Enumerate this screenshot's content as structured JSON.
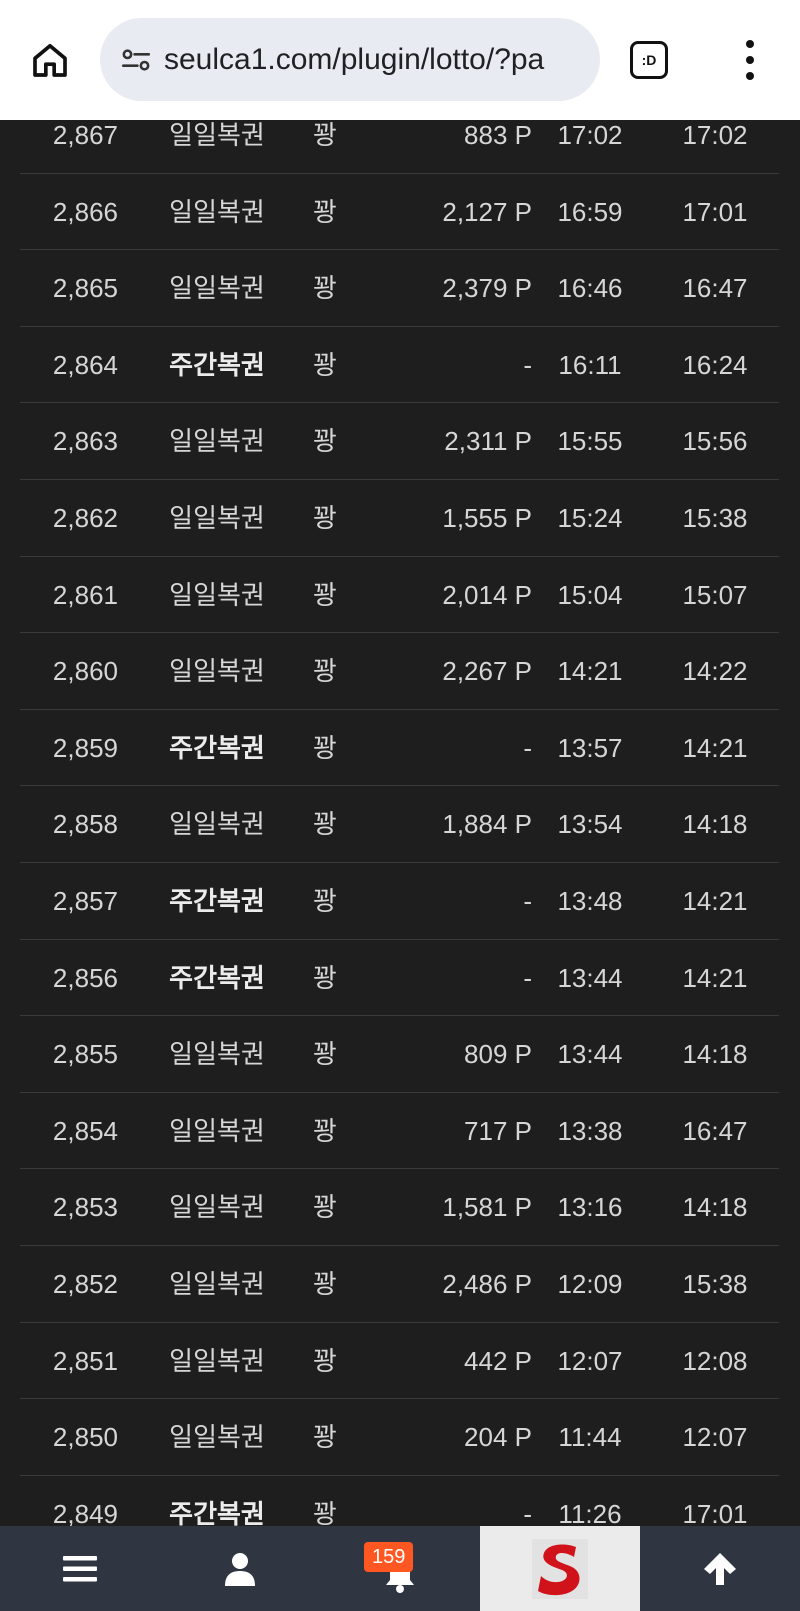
{
  "browser": {
    "url": "seulca1.com/plugin/lotto/?pa",
    "tab_label": ":D",
    "icons": [
      "home-icon",
      "site-info-icon",
      "tab-switcher-icon",
      "more-menu-icon"
    ]
  },
  "rows": [
    {
      "num": "2,867",
      "type": "일일복권",
      "bold": false,
      "result": "꽝",
      "points": "883 P",
      "time1": "17:02",
      "time2": "17:02"
    },
    {
      "num": "2,866",
      "type": "일일복권",
      "bold": false,
      "result": "꽝",
      "points": "2,127 P",
      "time1": "16:59",
      "time2": "17:01"
    },
    {
      "num": "2,865",
      "type": "일일복권",
      "bold": false,
      "result": "꽝",
      "points": "2,379 P",
      "time1": "16:46",
      "time2": "16:47"
    },
    {
      "num": "2,864",
      "type": "주간복권",
      "bold": true,
      "result": "꽝",
      "points": "-",
      "time1": "16:11",
      "time2": "16:24"
    },
    {
      "num": "2,863",
      "type": "일일복권",
      "bold": false,
      "result": "꽝",
      "points": "2,311 P",
      "time1": "15:55",
      "time2": "15:56"
    },
    {
      "num": "2,862",
      "type": "일일복권",
      "bold": false,
      "result": "꽝",
      "points": "1,555 P",
      "time1": "15:24",
      "time2": "15:38"
    },
    {
      "num": "2,861",
      "type": "일일복권",
      "bold": false,
      "result": "꽝",
      "points": "2,014 P",
      "time1": "15:04",
      "time2": "15:07"
    },
    {
      "num": "2,860",
      "type": "일일복권",
      "bold": false,
      "result": "꽝",
      "points": "2,267 P",
      "time1": "14:21",
      "time2": "14:22"
    },
    {
      "num": "2,859",
      "type": "주간복권",
      "bold": true,
      "result": "꽝",
      "points": "-",
      "time1": "13:57",
      "time2": "14:21"
    },
    {
      "num": "2,858",
      "type": "일일복권",
      "bold": false,
      "result": "꽝",
      "points": "1,884 P",
      "time1": "13:54",
      "time2": "14:18"
    },
    {
      "num": "2,857",
      "type": "주간복권",
      "bold": true,
      "result": "꽝",
      "points": "-",
      "time1": "13:48",
      "time2": "14:21"
    },
    {
      "num": "2,856",
      "type": "주간복권",
      "bold": true,
      "result": "꽝",
      "points": "-",
      "time1": "13:44",
      "time2": "14:21"
    },
    {
      "num": "2,855",
      "type": "일일복권",
      "bold": false,
      "result": "꽝",
      "points": "809 P",
      "time1": "13:44",
      "time2": "14:18"
    },
    {
      "num": "2,854",
      "type": "일일복권",
      "bold": false,
      "result": "꽝",
      "points": "717 P",
      "time1": "13:38",
      "time2": "16:47"
    },
    {
      "num": "2,853",
      "type": "일일복권",
      "bold": false,
      "result": "꽝",
      "points": "1,581 P",
      "time1": "13:16",
      "time2": "14:18"
    },
    {
      "num": "2,852",
      "type": "일일복권",
      "bold": false,
      "result": "꽝",
      "points": "2,486 P",
      "time1": "12:09",
      "time2": "15:38"
    },
    {
      "num": "2,851",
      "type": "일일복권",
      "bold": false,
      "result": "꽝",
      "points": "442 P",
      "time1": "12:07",
      "time2": "12:08"
    },
    {
      "num": "2,850",
      "type": "일일복권",
      "bold": false,
      "result": "꽝",
      "points": "204 P",
      "time1": "11:44",
      "time2": "12:07"
    },
    {
      "num": "2,849",
      "type": "주간복권",
      "bold": true,
      "result": "꽝",
      "points": "-",
      "time1": "11:26",
      "time2": "17:01"
    }
  ],
  "bottom_nav": {
    "badge_count": "159",
    "icons": [
      "hamburger-menu-icon",
      "user-icon",
      "bell-icon",
      "site-logo",
      "arrow-up-icon"
    ],
    "colors": {
      "background": "#2f3642",
      "badge": "#ff5722",
      "logo_red": "#d0121b"
    }
  }
}
